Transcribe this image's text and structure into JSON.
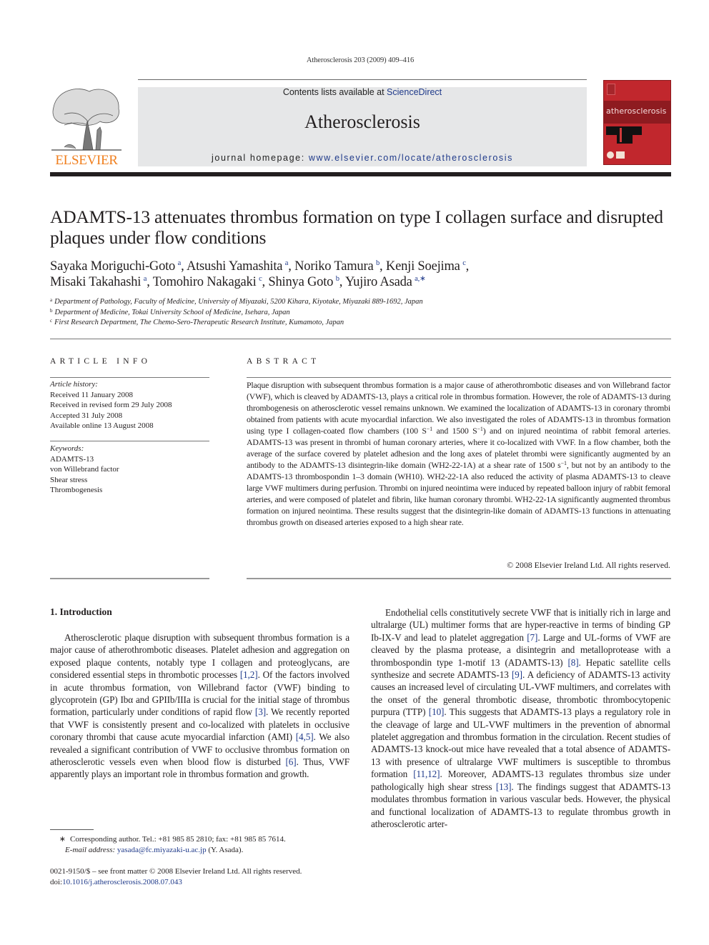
{
  "running_head": "Atherosclerosis 203 (2009) 409–416",
  "header": {
    "publisher_logo": "ELSEVIER",
    "logo_icon": "elsevier-tree-icon",
    "contents_prefix": "Contents lists available at ",
    "contents_link": "ScienceDirect",
    "journal_title": "Atherosclerosis",
    "homepage_prefix": "journal homepage: ",
    "homepage_link": "www.elsevier.com/locate/atherosclerosis",
    "cover_title": "atherosclerosis",
    "colors": {
      "link": "#1f3a8a",
      "elsevier_orange": "#f07f1e",
      "cover_red": "#c1272d",
      "header_gray": "#e6e7e8"
    }
  },
  "article": {
    "title": "ADAMTS-13 attenuates thrombus formation on type I collagen surface and disrupted plaques under flow conditions",
    "authors": [
      {
        "name": "Sayaka Moriguchi-Goto",
        "aff": "a",
        "sep": ", "
      },
      {
        "name": "Atsushi Yamashita",
        "aff": "a",
        "sep": ", "
      },
      {
        "name": "Noriko Tamura",
        "aff": "b",
        "sep": ", "
      },
      {
        "name": "Kenji Soejima",
        "aff": "c",
        "sep": ","
      },
      {
        "name": "Misaki Takahashi",
        "aff": "a",
        "sep": ", "
      },
      {
        "name": "Tomohiro Nakagaki",
        "aff": "c",
        "sep": ", "
      },
      {
        "name": "Shinya Goto",
        "aff": "b",
        "sep": ", "
      },
      {
        "name": "Yujiro Asada",
        "aff": "a,∗",
        "sep": ""
      }
    ],
    "affiliations": [
      {
        "key": "a",
        "text": "Department of Pathology, Faculty of Medicine, University of Miyazaki, 5200 Kihara, Kiyotake, Miyazaki 889-1692, Japan"
      },
      {
        "key": "b",
        "text": "Department of Medicine, Tokai University School of Medicine, Isehara, Japan"
      },
      {
        "key": "c",
        "text": "First Research Department, The Chemo-Sero-Therapeutic Research Institute, Kumamoto, Japan"
      }
    ]
  },
  "article_info": {
    "heading": "ARTICLE INFO",
    "history_label": "Article history:",
    "history": [
      "Received 11 January 2008",
      "Received in revised form 29 July 2008",
      "Accepted 31 July 2008",
      "Available online 13 August 2008"
    ],
    "keywords_label": "Keywords:",
    "keywords": [
      "ADAMTS-13",
      "von Willebrand factor",
      "Shear stress",
      "Thrombogenesis"
    ]
  },
  "abstract": {
    "heading": "ABSTRACT",
    "part1": "Plaque disruption with subsequent thrombus formation is a major cause of atherothrombotic diseases and von Willebrand factor (VWF), which is cleaved by ADAMTS-13, plays a critical role in thrombus formation. However, the role of ADAMTS-13 during thrombogenesis on atherosclerotic vessel remains unknown. We examined the localization of ADAMTS-13 in coronary thrombi obtained from patients with acute myocardial infarction. We also investigated the roles of ADAMTS-13 in thrombus formation using type I collagen-coated flow chambers (100 S",
    "sup1": "−1",
    "part2": " and 1500 S",
    "sup2": "−1",
    "part3": ") and on injured neointima of rabbit femoral arteries. ADAMTS-13 was present in thrombi of human coronary arteries, where it co-localized with VWF. In a flow chamber, both the average of the surface covered by platelet adhesion and the long axes of platelet thrombi were significantly augmented by an antibody to the ADAMTS-13 disintegrin-like domain (WH2-22-1A) at a shear rate of 1500 s",
    "sup3": "−1",
    "part4": ", but not by an antibody to the ADAMTS-13 thrombospondin 1–3 domain (WH10). WH2-22-1A also reduced the activity of plasma ADAMTS-13 to cleave large VWF multimers during perfusion. Thrombi on injured neointima were induced by repeated balloon injury of rabbit femoral arteries, and were composed of platelet and fibrin, like human coronary thrombi. WH2-22-1A significantly augmented thrombus formation on injured neointima. These results suggest that the disintegrin-like domain of ADAMTS-13 functions in attenuating thrombus growth on diseased arteries exposed to a high shear rate.",
    "copyright": "© 2008 Elsevier Ireland Ltd. All rights reserved."
  },
  "body": {
    "section_heading": "1.  Introduction",
    "left_paragraph": [
      {
        "t": "Atherosclerotic plaque disruption with subsequent thrombus formation is a major cause of atherothrombotic diseases. Platelet adhesion and aggregation on exposed plaque contents, notably type I collagen and proteoglycans, are considered essential steps in thrombotic processes "
      },
      {
        "ref": "[1,2]"
      },
      {
        "t": ". Of the factors involved in acute thrombus formation, von Willebrand factor (VWF) binding to glycoprotein (GP) Ibα and GPIIb/IIIa is crucial for the initial stage of thrombus formation, particularly under conditions of rapid flow "
      },
      {
        "ref": "[3]"
      },
      {
        "t": ". We recently reported that VWF is consistently present and co-localized with platelets in occlusive coronary thrombi that cause acute myocardial infarction (AMI) "
      },
      {
        "ref": "[4,5]"
      },
      {
        "t": ". We also revealed a significant contribution of VWF to occlusive thrombus formation on atherosclerotic vessels even when blood flow is disturbed "
      },
      {
        "ref": "[6]"
      },
      {
        "t": ". Thus, VWF apparently plays an important role in thrombus formation and growth."
      }
    ],
    "right_paragraph": [
      {
        "t": "Endothelial cells constitutively secrete VWF that is initially rich in large and ultralarge (UL) multimer forms that are hyper-reactive in terms of binding GP Ib-IX-V and lead to platelet aggregation "
      },
      {
        "ref": "[7]"
      },
      {
        "t": ". Large and UL-forms of VWF are cleaved by the plasma protease, a disintegrin and metalloprotease with a thrombospondin type 1-motif 13 (ADAMTS-13) "
      },
      {
        "ref": "[8]"
      },
      {
        "t": ". Hepatic satellite cells synthesize and secrete ADAMTS-13 "
      },
      {
        "ref": "[9]"
      },
      {
        "t": ". A deficiency of ADAMTS-13 activity causes an increased level of circulating UL-VWF multimers, and correlates with the onset of the general thrombotic disease, thrombotic thrombocytopenic purpura (TTP) "
      },
      {
        "ref": "[10]"
      },
      {
        "t": ". This suggests that ADAMTS-13 plays a regulatory role in the cleavage of large and UL-VWF multimers in the prevention of abnormal platelet aggregation and thrombus formation in the circulation. Recent studies of ADAMTS-13 knock-out mice have revealed that a total absence of ADAMTS-13 with presence of ultralarge VWF multimers is susceptible to thrombus formation "
      },
      {
        "ref": "[11,12]"
      },
      {
        "t": ". Moreover, ADAMTS-13 regulates thrombus size under pathologically high shear stress "
      },
      {
        "ref": "[13]"
      },
      {
        "t": ". The findings suggest that ADAMTS-13 modulates thrombus formation in various vascular beds. However, the physical and functional localization of ADAMTS-13 to regulate thrombus growth in atherosclerotic arter-"
      }
    ]
  },
  "footnote": {
    "marker": "∗",
    "corresponding": "Corresponding author. Tel.: +81 985 85 2810; fax: +81 985 85 7614.",
    "email_label": "E-mail address: ",
    "email": "yasada@fc.miyazaki-u.ac.jp",
    "email_suffix": " (Y. Asada)."
  },
  "front_matter": {
    "issn_line": "0021-9150/$ – see front matter © 2008 Elsevier Ireland Ltd. All rights reserved.",
    "doi_prefix": "doi:",
    "doi": "10.1016/j.atherosclerosis.2008.07.043"
  }
}
